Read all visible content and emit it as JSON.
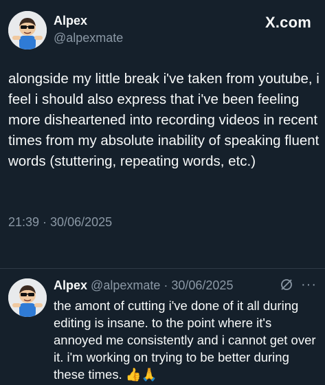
{
  "main_tweet": {
    "author_name": "Alpex",
    "handle": "@alpexmate",
    "brand": "X.com",
    "text": "alongside my little break i've taken from youtube, i feel i should also express that i've been feeling more disheartened into recording videos in recent times from my absolute inability of speaking fluent words (stuttering, repeating words, etc.)",
    "timestamp": "21:39 · 30/06/2025"
  },
  "reply_tweet": {
    "author_name": "Alpex",
    "meta": "@alpexmate · 30/06/2025",
    "text": "the amont of cutting i've done of it all during editing is insane. to the point where it's annoyed me consistently and i cannot get over it. i'm working on trying to be better during these times.",
    "emojis": "👍🙏",
    "more_label": "···"
  },
  "colors": {
    "background": "#15202b",
    "text_primary": "#f7f9f9",
    "text_secondary": "#8b98a5",
    "divider": "#2f3b47"
  },
  "icons": {
    "avatar": "avatar-cartoon-icon",
    "grok": "grok-icon",
    "more": "more-dots-icon"
  }
}
